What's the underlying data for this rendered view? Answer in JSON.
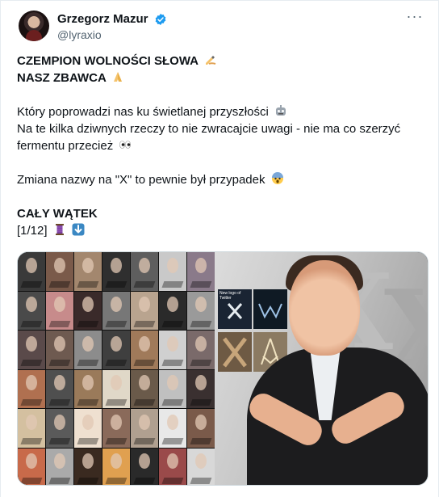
{
  "author": {
    "display_name": "Grzegorz Mazur",
    "handle": "@lyraxio",
    "verified_color": "#1d9bf0",
    "avatar_icon": "avatar"
  },
  "menu": {
    "more_label": "···"
  },
  "tweet": {
    "line1": "CZEMPION WOLNOŚCI SŁOWA",
    "line2": "NASZ ZBAWCA",
    "line3": "Który poprowadzi nas ku świetlanej przyszłości",
    "line4": "Na te kilka dziwnych rzeczy to nie zwracajcie uwagi - nie ma co szerzyć",
    "line5": "fermentu przecież",
    "line6": "Zmiana nazwy na \"X\" to pewnie był przypadek",
    "line7": "CAŁY WĄTEK",
    "line8": "[1/12]",
    "emojis": [
      "writing-hand-icon",
      "folded-hands-icon",
      "robot-icon",
      "eyes-icon",
      "shocked-face-icon",
      "thread-icon",
      "down-arrow-icon"
    ]
  },
  "media": {
    "logo_caption": "New logo of Twitter",
    "x_letter": "X",
    "grid_colors": [
      "#3a3a3a",
      "#7a5a4a",
      "#a3876e",
      "#2f2f2f",
      "#5e5e5e",
      "#c9c9c9",
      "#8a7a8a",
      "#4a4a4a",
      "#c78b8b",
      "#3a2a2a",
      "#777777",
      "#b9a48f",
      "#2a2a2a",
      "#9a9a9a",
      "#5a4a4a",
      "#6e5a50",
      "#8c8c8c",
      "#3f3f3f",
      "#a07a5a",
      "#d0d0d0",
      "#7a6a6a",
      "#b07050",
      "#4f4f4f",
      "#9a7a5a",
      "#e0d8c8",
      "#6a5a4a",
      "#c0c0c0",
      "#3a3030",
      "#d4c0a0",
      "#5a5a5a",
      "#efe0d0",
      "#8a6a5a",
      "#b0a090",
      "#e8e8e8",
      "#7a5a4a",
      "#c86a4a",
      "#aaaaaa",
      "#3a2a20",
      "#e0a050",
      "#2a2a2a",
      "#9a4a4a",
      "#d8d8d8"
    ]
  }
}
